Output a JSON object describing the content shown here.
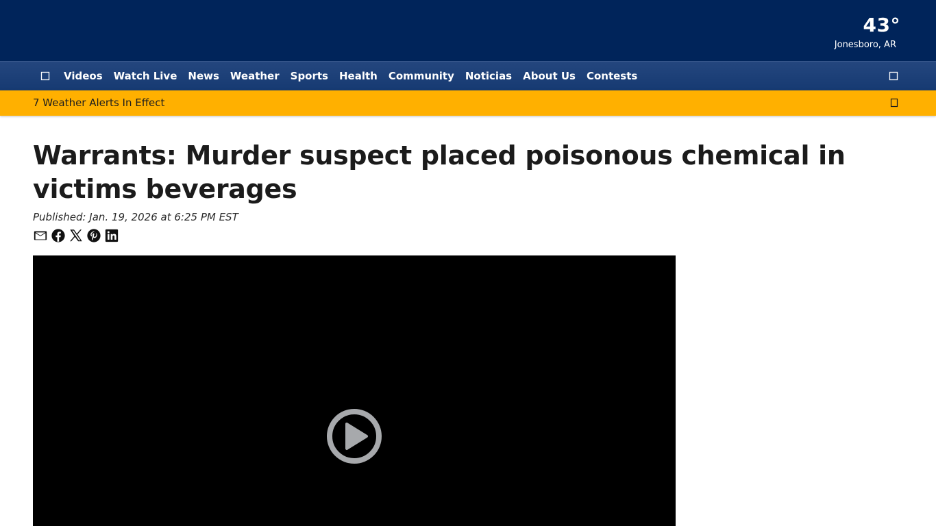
{
  "weather": {
    "temperature": "43°",
    "location": "Jonesboro, AR"
  },
  "nav": {
    "home_icon": "home-icon",
    "search_icon": "search-icon",
    "items": [
      {
        "label": "Videos"
      },
      {
        "label": "Watch Live"
      },
      {
        "label": "News"
      },
      {
        "label": "Weather"
      },
      {
        "label": "Sports"
      },
      {
        "label": "Health"
      },
      {
        "label": "Community"
      },
      {
        "label": "Noticias"
      },
      {
        "label": "About Us"
      },
      {
        "label": "Contests"
      }
    ]
  },
  "alert_bar": {
    "text": "7 Weather Alerts In Effect",
    "chevron_icon": "chevron-down-icon"
  },
  "article": {
    "headline": "Warrants: Murder suspect placed poisonous chemical in victims beverages",
    "published": "Published: Jan. 19, 2026 at 6:25 PM EST",
    "share_icons": [
      "email-icon",
      "facebook-icon",
      "x-icon",
      "pinterest-icon",
      "linkedin-icon"
    ]
  },
  "video": {
    "play_icon": "play-icon"
  },
  "colors": {
    "header_bg": "#00245a",
    "nav_bg": "#1d3f78",
    "alert_bg": "#ffb000",
    "text_dark": "#1b1b1b",
    "video_bg": "#000000",
    "play_icon": "#a7a9ac"
  }
}
